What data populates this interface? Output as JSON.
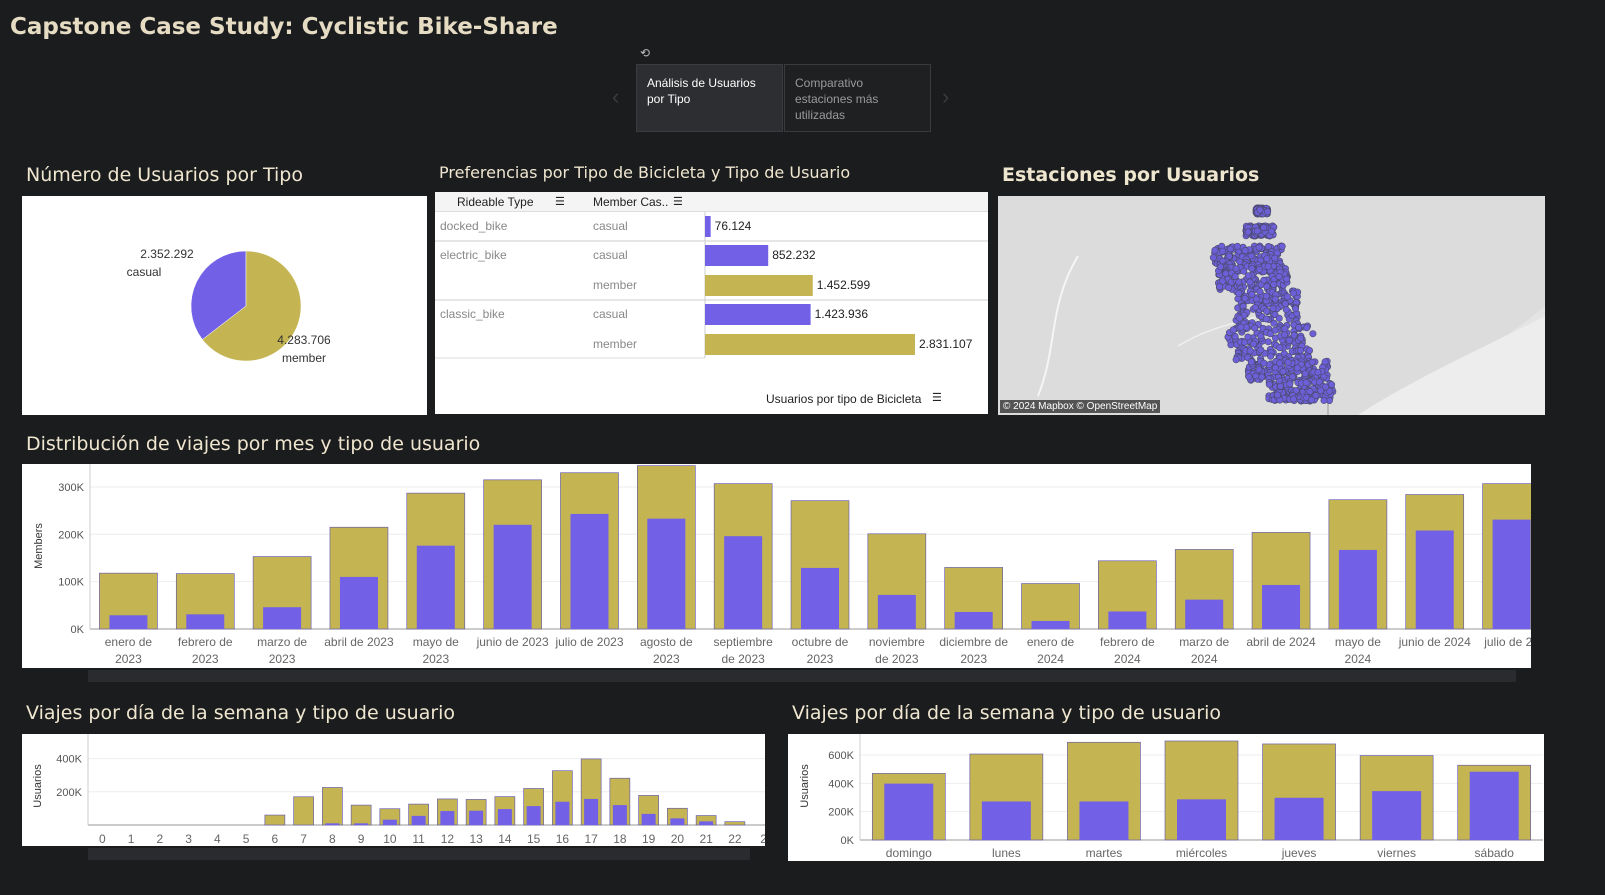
{
  "header": {
    "title": "Capstone Case Study: Cyclistic Bike-Share"
  },
  "story": {
    "tabs": [
      {
        "label": "Análisis de Usuarios por Tipo",
        "active": true
      },
      {
        "label": "Comparativo estaciones más utilizadas",
        "active": false
      }
    ],
    "refresh_icon": "refresh-icon",
    "prev_icon": "chevron-left-icon",
    "next_icon": "chevron-right-icon"
  },
  "colors": {
    "casual": "#7260e6",
    "member": "#c4b552",
    "background": "#1b1c1e"
  },
  "pie": {
    "title": "Número de Usuarios por Tipo",
    "chart_data": {
      "type": "pie",
      "slices": [
        {
          "label": "casual",
          "value": 2352292,
          "value_text": "2.352.292"
        },
        {
          "label": "member",
          "value": 4283706,
          "value_text": "4.283.706"
        }
      ]
    }
  },
  "prefs": {
    "title": "Preferencias por Tipo de Bicicleta y Tipo de Usuario",
    "col1": "Rideable Type",
    "col2": "Member Cas..",
    "axis_label": "Usuarios por tipo de Bicicleta",
    "chart_data": {
      "type": "bar",
      "rows": [
        {
          "rideable": "docked_bike",
          "member_casual": "casual",
          "value": 76124,
          "value_text": "76.124"
        },
        {
          "rideable": "electric_bike",
          "member_casual": "casual",
          "value": 852232,
          "value_text": "852.232"
        },
        {
          "rideable": "",
          "member_casual": "member",
          "value": 1452599,
          "value_text": "1.452.599"
        },
        {
          "rideable": "classic_bike",
          "member_casual": "casual",
          "value": 1423936,
          "value_text": "1.423.936"
        },
        {
          "rideable": "",
          "member_casual": "member",
          "value": 2831107,
          "value_text": "2.831.107"
        }
      ]
    }
  },
  "map": {
    "title": "Estaciones por Usuarios",
    "attribution": "© 2024 Mapbox  © OpenStreetMap"
  },
  "monthly": {
    "title": "Distribución de viajes por mes y tipo de usuario",
    "ylabel": "Members",
    "yticks": [
      "0K",
      "100K",
      "200K",
      "300K"
    ],
    "chart_data": {
      "type": "bar",
      "ylim": [
        0,
        340000
      ],
      "categories": [
        [
          "enero de",
          "2023"
        ],
        [
          "febrero de",
          "2023"
        ],
        [
          "marzo de",
          "2023"
        ],
        [
          "abril de 2023",
          ""
        ],
        [
          "mayo de",
          "2023"
        ],
        [
          "junio de 2023",
          ""
        ],
        [
          "julio de 2023",
          ""
        ],
        [
          "agosto de",
          "2023"
        ],
        [
          "septiembre",
          "de 2023"
        ],
        [
          "octubre de",
          "2023"
        ],
        [
          "noviembre",
          "de 2023"
        ],
        [
          "diciembre de",
          "2023"
        ],
        [
          "enero de",
          "2024"
        ],
        [
          "febrero de",
          "2024"
        ],
        [
          "marzo de",
          "2024"
        ],
        [
          "abril de 2024",
          ""
        ],
        [
          "mayo de",
          "2024"
        ],
        [
          "junio de 2024",
          ""
        ],
        [
          "julio de 20",
          ""
        ]
      ],
      "series": [
        {
          "name": "member",
          "values": [
            118000,
            117000,
            153000,
            215000,
            287000,
            315000,
            330000,
            345000,
            307000,
            271000,
            201000,
            130000,
            96000,
            144000,
            168000,
            204000,
            273000,
            284000,
            307000
          ]
        },
        {
          "name": "casual",
          "values": [
            29000,
            31000,
            46000,
            110000,
            176000,
            220000,
            243000,
            233000,
            196000,
            129000,
            72000,
            36000,
            17000,
            37000,
            62000,
            93000,
            167000,
            208000,
            231000
          ]
        }
      ]
    }
  },
  "hourly": {
    "title": "Viajes por día de la semana y tipo de usuario",
    "ylabel": "Usuarios",
    "yticks": [
      "200K",
      "400K"
    ],
    "chart_data": {
      "type": "bar",
      "ylim": [
        0,
        500000
      ],
      "categories": [
        "0",
        "1",
        "2",
        "3",
        "4",
        "5",
        "6",
        "7",
        "8",
        "9",
        "10",
        "11",
        "12",
        "13",
        "14",
        "15",
        "16",
        "17",
        "18",
        "19",
        "20",
        "21",
        "22",
        "2"
      ],
      "series": [
        {
          "name": "member",
          "values": [
            0,
            0,
            0,
            0,
            0,
            0,
            60000,
            170000,
            226000,
            120000,
            98000,
            126000,
            157000,
            154000,
            171000,
            220000,
            327000,
            398000,
            282000,
            178000,
            101000,
            57000,
            20000,
            0
          ]
        },
        {
          "name": "casual",
          "values": [
            0,
            0,
            0,
            0,
            0,
            0,
            0,
            0,
            10000,
            10000,
            32000,
            55000,
            84000,
            86000,
            96000,
            114000,
            140000,
            157000,
            120000,
            67000,
            40000,
            22000,
            0,
            0
          ]
        }
      ]
    }
  },
  "weekday": {
    "title": "Viajes por día de la semana y tipo de usuario",
    "ylabel": "Usuarios",
    "yticks": [
      "0K",
      "200K",
      "400K",
      "600K"
    ],
    "chart_data": {
      "type": "bar",
      "ylim": [
        0,
        720000
      ],
      "categories": [
        "domingo",
        "lunes",
        "martes",
        "miércoles",
        "jueves",
        "viernes",
        "sábado"
      ],
      "series": [
        {
          "name": "member",
          "values": [
            470000,
            607000,
            690000,
            699000,
            678000,
            596000,
            528000
          ]
        },
        {
          "name": "casual",
          "values": [
            398000,
            272000,
            272000,
            287000,
            298000,
            345000,
            482000
          ]
        }
      ]
    }
  }
}
